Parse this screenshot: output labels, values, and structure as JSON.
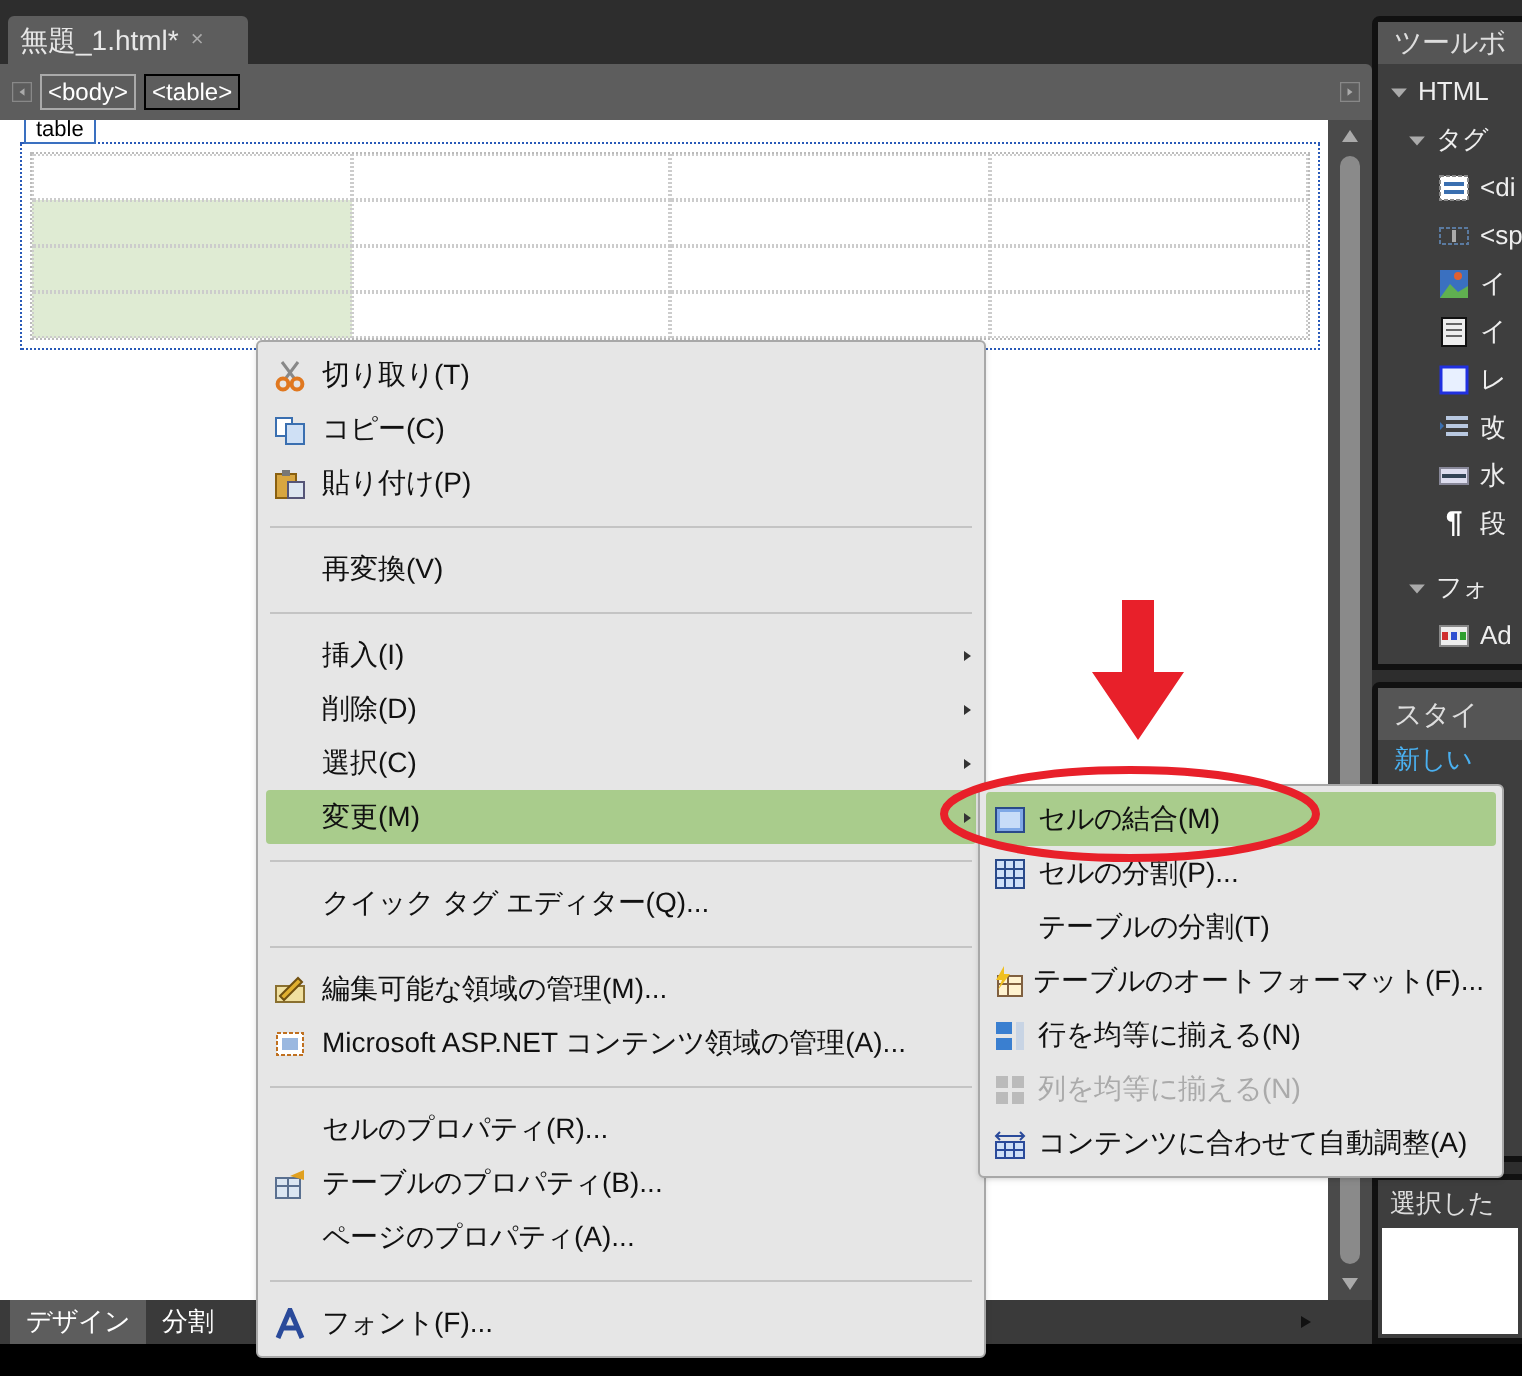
{
  "document_tab": {
    "title": "無題_1.html*",
    "close": "×"
  },
  "breadcrumb": [
    {
      "label": "<body>",
      "selected": false
    },
    {
      "label": "<table>",
      "selected": true
    }
  ],
  "table_label": "table",
  "design_table": {
    "rows": [
      {
        "cells": [
          {
            "selected": false
          },
          {
            "selected": false
          },
          {
            "selected": false
          },
          {
            "selected": false
          }
        ]
      },
      {
        "cells": [
          {
            "selected": true
          },
          {
            "selected": false
          },
          {
            "selected": false
          },
          {
            "selected": false
          }
        ]
      },
      {
        "cells": [
          {
            "selected": true
          },
          {
            "selected": false
          },
          {
            "selected": false
          },
          {
            "selected": false
          }
        ]
      },
      {
        "cells": [
          {
            "selected": true
          },
          {
            "selected": false
          },
          {
            "selected": false
          },
          {
            "selected": false
          }
        ]
      }
    ]
  },
  "view_tabs": [
    {
      "label": "デザイン",
      "selected": true
    },
    {
      "label": "分割",
      "selected": false
    }
  ],
  "context_menu": [
    {
      "kind": "item",
      "label": "切り取り(T)",
      "submenu": false,
      "selected": false
    },
    {
      "kind": "item",
      "label": "コピー(C)",
      "submenu": false,
      "selected": false
    },
    {
      "kind": "item",
      "label": "貼り付け(P)",
      "submenu": false,
      "selected": false
    },
    {
      "kind": "separator"
    },
    {
      "kind": "item",
      "label": "再変換(V)",
      "submenu": false,
      "selected": false
    },
    {
      "kind": "separator"
    },
    {
      "kind": "item",
      "label": "挿入(I)",
      "submenu": true,
      "selected": false
    },
    {
      "kind": "item",
      "label": "削除(D)",
      "submenu": true,
      "selected": false
    },
    {
      "kind": "item",
      "label": "選択(C)",
      "submenu": true,
      "selected": false
    },
    {
      "kind": "item",
      "label": "変更(M)",
      "submenu": true,
      "selected": true
    },
    {
      "kind": "separator"
    },
    {
      "kind": "item",
      "label": "クイック タグ エディター(Q)...",
      "submenu": false,
      "selected": false
    },
    {
      "kind": "separator"
    },
    {
      "kind": "item",
      "label": "編集可能な領域の管理(M)...",
      "submenu": false,
      "selected": false
    },
    {
      "kind": "item",
      "label": "Microsoft ASP.NET コンテンツ領域の管理(A)...",
      "submenu": false,
      "selected": false
    },
    {
      "kind": "separator"
    },
    {
      "kind": "item",
      "label": "セルのプロパティ(R)...",
      "submenu": false,
      "selected": false
    },
    {
      "kind": "item",
      "label": "テーブルのプロパティ(B)...",
      "submenu": false,
      "selected": false
    },
    {
      "kind": "item",
      "label": "ページのプロパティ(A)...",
      "submenu": false,
      "selected": false
    },
    {
      "kind": "separator"
    },
    {
      "kind": "item",
      "label": "フォント(F)...",
      "submenu": false,
      "selected": false
    }
  ],
  "submenu": [
    {
      "label": "セルの結合(M)",
      "selected": true,
      "disabled": false
    },
    {
      "label": "セルの分割(P)...",
      "selected": false,
      "disabled": false
    },
    {
      "label": "テーブルの分割(T)",
      "selected": false,
      "disabled": false
    },
    {
      "label": "テーブルのオートフォーマット(F)...",
      "selected": false,
      "disabled": false
    },
    {
      "label": "行を均等に揃える(N)",
      "selected": false,
      "disabled": false
    },
    {
      "label": "列を均等に揃える(N)",
      "selected": false,
      "disabled": true
    },
    {
      "label": "コンテンツに合わせて自動調整(A)",
      "selected": false,
      "disabled": false
    }
  ],
  "toolbox": {
    "title": "ツールボ",
    "tree": [
      {
        "label": "HTML",
        "expanded": true,
        "children": [
          {
            "label": "タグ",
            "expanded": true,
            "children": [
              {
                "label": "<di"
              },
              {
                "label": "<sp"
              },
              {
                "label": "イ"
              },
              {
                "label": "イ"
              },
              {
                "label": "レ"
              },
              {
                "label": "改"
              },
              {
                "label": "水"
              },
              {
                "label": "段",
                "glyph": "¶"
              }
            ]
          },
          {
            "label": "フォ",
            "expanded": true,
            "children": [
              {
                "label": "Ad"
              }
            ]
          }
        ]
      }
    ]
  },
  "styles_panel": {
    "title": "スタイ",
    "link": "新しい"
  },
  "selected_panel": {
    "title": "選択した"
  }
}
